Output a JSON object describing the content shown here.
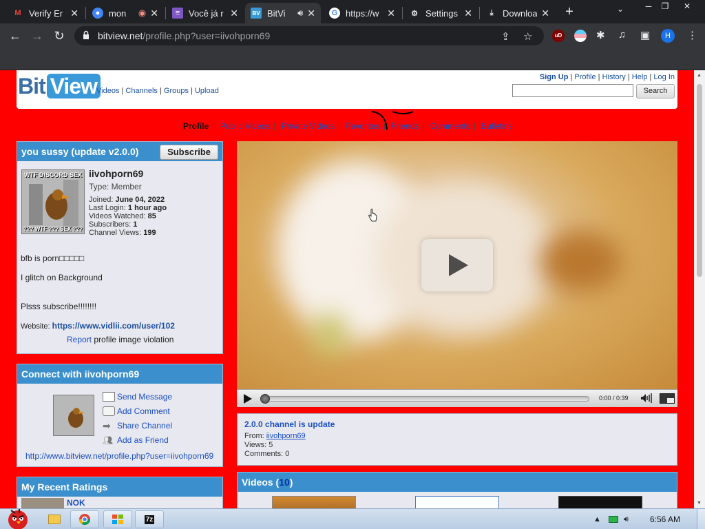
{
  "browser": {
    "tabs": [
      {
        "title": "Verify Er",
        "icon": "gmail-icon",
        "active": false
      },
      {
        "title": "mon",
        "icon": "record-icon",
        "active": false
      },
      {
        "title": "Você já r",
        "icon": "doc-icon",
        "active": false
      },
      {
        "title": "BitVi",
        "icon": "bitview-icon",
        "active": true
      },
      {
        "title": "https://w",
        "icon": "google-icon",
        "active": false
      },
      {
        "title": "Settings",
        "icon": "gear-icon",
        "active": false
      },
      {
        "title": "Downloa",
        "icon": "download-icon",
        "active": false
      }
    ],
    "url_host": "bitview.net",
    "url_path": "/profile.php?user=iivohporn69",
    "profile_initial": "H",
    "ext_ublock": "uD"
  },
  "site": {
    "logo_bit": "Bit",
    "logo_view": "View",
    "nav": [
      "Videos",
      "Channels",
      "Groups",
      "Upload"
    ],
    "user_nav": [
      "Sign Up",
      "Profile",
      "History",
      "Help",
      "Log In"
    ],
    "search_placeholder": "",
    "search_button": "Search"
  },
  "profile_tabs": [
    "Profile",
    "Public Videos",
    "Private Videos",
    "Favorites",
    "Friends",
    "Comments",
    "Bulletins"
  ],
  "channel": {
    "title": "you sussy (update v2.0.0)",
    "subscribe_label": "Subscribe",
    "avatar_top": "WTF DISCORD SEX",
    "avatar_bottom": "??? WTF ??? SEX ???",
    "username": "iivohporn69",
    "type": "Type: Member",
    "joined_label": "Joined:",
    "joined_value": "June 04, 2022",
    "last_login_label": "Last Login:",
    "last_login_value": "1 hour ago",
    "videos_watched_label": "Videos Watched:",
    "videos_watched_value": "85",
    "subscribers_label": "Subscribers:",
    "subscribers_value": "1",
    "channel_views_label": "Channel Views:",
    "channel_views_value": "199",
    "about_1": "bfb is porn□□□□□",
    "about_2": "I glitch on Background",
    "about_3": "Plsss subscribe!!!!!!!!",
    "website_label": "Website:",
    "website_url": "https://www.vidlii.com/user/102",
    "report_link": "Report",
    "report_text": "profile image violation"
  },
  "connect": {
    "title": "Connect with iivohporn69",
    "links": [
      "Send Message",
      "Add Comment",
      "Share Channel",
      "Add as Friend"
    ],
    "channel_url": "http://www.bitview.net/profile.php?user=iivohporn69"
  },
  "ratings": {
    "title": "My Recent Ratings",
    "first_item": "NOK"
  },
  "player": {
    "time": "0:00 / 0:39",
    "progress": 0
  },
  "video_info": {
    "title": "2.0.0 channel is update",
    "from_label": "From:",
    "from_user": "iivohporn69",
    "views": "Views: 5",
    "comments": "Comments: 0"
  },
  "videos": {
    "title_prefix": "Videos (",
    "count": "10",
    "title_suffix": ")"
  },
  "taskbar": {
    "clock": "6:56 AM",
    "app_label": "7z"
  },
  "colors": {
    "page_bg": "#ff0000",
    "box_head": "#3a8fcc",
    "link": "#1a4fc0"
  }
}
